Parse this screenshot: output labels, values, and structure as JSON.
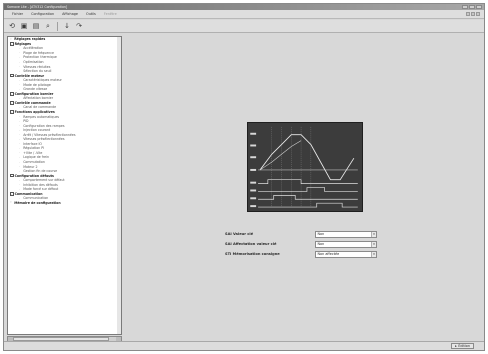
{
  "window": {
    "title": "Somove Lite - [ATV312 Configuration]"
  },
  "menubar": {
    "items": [
      "Fichier",
      "Configuration",
      "Affichage",
      "Outils",
      "Fenêtre"
    ],
    "disabled_index": 4
  },
  "toolbar": {
    "buttons": [
      {
        "icon": "open-folder-icon",
        "glyph": "⟲"
      },
      {
        "icon": "save-icon",
        "glyph": "▣"
      },
      {
        "icon": "print-icon",
        "glyph": "▤"
      },
      {
        "icon": "zoom-icon",
        "glyph": "⌕"
      },
      {
        "icon": "arrow-down-icon",
        "glyph": "↓"
      },
      {
        "icon": "help-icon",
        "glyph": "↷"
      }
    ]
  },
  "tree": {
    "items": [
      {
        "level": 0,
        "label": "Réglages rapides",
        "expander": ""
      },
      {
        "level": 0,
        "label": "Réglages",
        "expander": "-"
      },
      {
        "level": 1,
        "label": "Accélération",
        "expander": ""
      },
      {
        "level": 1,
        "label": "Plage de fréquence",
        "expander": ""
      },
      {
        "level": 1,
        "label": "Protection thermique",
        "expander": ""
      },
      {
        "level": 1,
        "label": "Optimisation",
        "expander": ""
      },
      {
        "level": 1,
        "label": "Vitesses réduites",
        "expander": ""
      },
      {
        "level": 1,
        "label": "Sélection du seuil",
        "expander": ""
      },
      {
        "level": 0,
        "label": "Contrôle moteur",
        "expander": "-"
      },
      {
        "level": 1,
        "label": "Caractéristiques moteur",
        "expander": ""
      },
      {
        "level": 1,
        "label": "Mode de pilotage",
        "expander": ""
      },
      {
        "level": 1,
        "label": "Grande vitesse",
        "expander": ""
      },
      {
        "level": 0,
        "label": "Configuration bornier",
        "expander": "-"
      },
      {
        "level": 1,
        "label": "Affectation bornier",
        "expander": ""
      },
      {
        "level": 0,
        "label": "Contrôle commande",
        "expander": "-"
      },
      {
        "level": 1,
        "label": "Canal de commande",
        "expander": ""
      },
      {
        "level": 0,
        "label": "Fonctions applicatives",
        "expander": "-"
      },
      {
        "level": 1,
        "label": "Rampes automatiques",
        "expander": ""
      },
      {
        "level": 1,
        "label": "PID",
        "expander": ""
      },
      {
        "level": 1,
        "label": "Configuration des rampes",
        "expander": ""
      },
      {
        "level": 1,
        "label": "Injection courant",
        "expander": ""
      },
      {
        "level": 1,
        "label": "Arrêt / Vitesses présélectionnées",
        "expander": ""
      },
      {
        "level": 1,
        "label": "Vitesses présélectionnées",
        "expander": ""
      },
      {
        "level": 1,
        "label": "Interface IO",
        "expander": ""
      },
      {
        "level": 1,
        "label": "Régulation PI",
        "expander": ""
      },
      {
        "level": 1,
        "label": "+Vite / -Vite",
        "expander": ""
      },
      {
        "level": 1,
        "label": "Logique de frein",
        "expander": ""
      },
      {
        "level": 1,
        "label": "Commutation",
        "expander": ""
      },
      {
        "level": 1,
        "label": "Moteur 2",
        "expander": ""
      },
      {
        "level": 1,
        "label": "Gestion fin de course",
        "expander": ""
      },
      {
        "level": 0,
        "label": "Configuration défauts",
        "expander": "-"
      },
      {
        "level": 1,
        "label": "Comportement sur défaut",
        "expander": ""
      },
      {
        "level": 1,
        "label": "Inhibition des défauts",
        "expander": ""
      },
      {
        "level": 1,
        "label": "Mode forcé sur défaut",
        "expander": ""
      },
      {
        "level": 0,
        "label": "Communication",
        "expander": "-"
      },
      {
        "level": 1,
        "label": "Communication",
        "expander": ""
      },
      {
        "level": 0,
        "label": "Mémoire de configuration",
        "expander": ""
      }
    ]
  },
  "params": [
    {
      "label": "SAI Valeur clé",
      "value": "Non"
    },
    {
      "label": "SAI Affectation valeur clé",
      "value": "Non"
    },
    {
      "label": "STI Mémorisation consigne",
      "value": "Non affectée"
    }
  ],
  "statusbar": {
    "mode": "Édition"
  }
}
